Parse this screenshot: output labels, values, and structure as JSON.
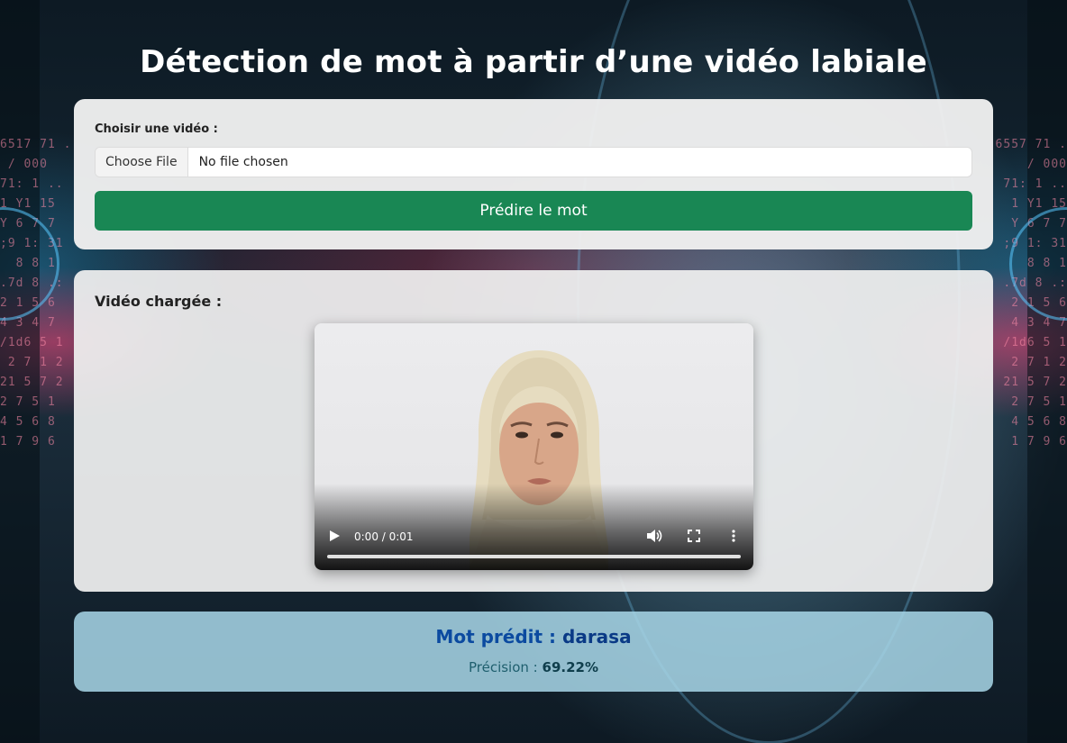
{
  "page": {
    "title": "Détection de mot à partir d’une vidéo labiale"
  },
  "upload": {
    "label": "Choisir une vidéo :",
    "file_button_label": "Choose File",
    "file_status": "No file chosen",
    "submit_label": "Prédire le mot"
  },
  "video": {
    "heading": "Vidéo chargée :",
    "time_display": "0:00 / 0:01",
    "progress_fraction": 0,
    "controls": [
      "play-icon",
      "volume-icon",
      "fullscreen-icon",
      "more-options-icon"
    ]
  },
  "result": {
    "prefix": "Mot prédit : ",
    "word": "darasa",
    "precision_label": "Précision : ",
    "precision_value": "69.22%"
  },
  "colors": {
    "primary_button": "#198754",
    "result_background": "#a8d6e8",
    "result_text": "#0b4aa0"
  }
}
